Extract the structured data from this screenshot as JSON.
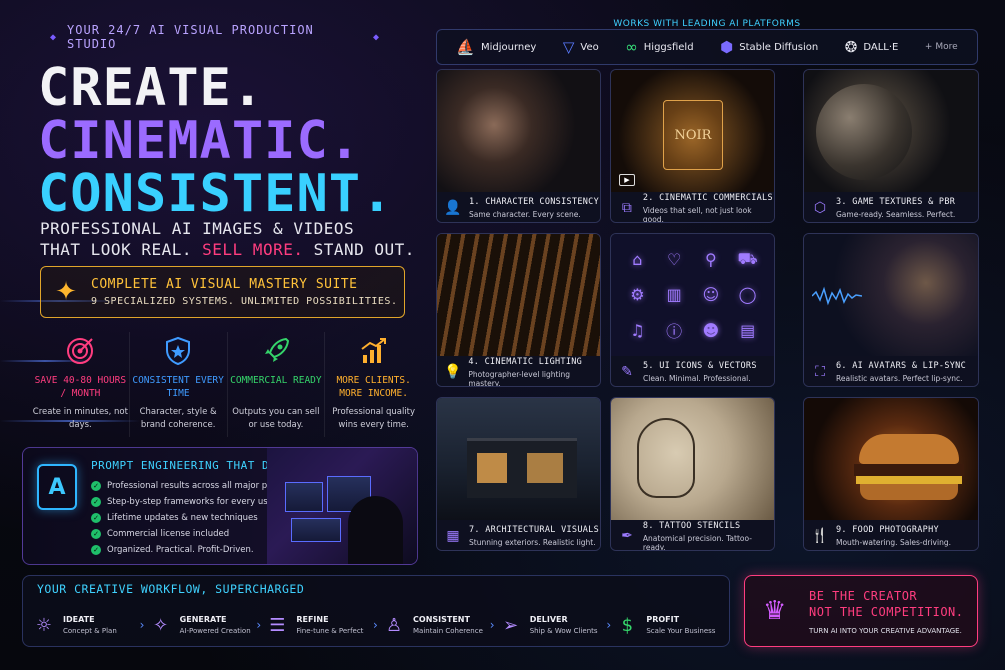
{
  "tagline": "YOUR 24/7 AI VISUAL PRODUCTION STUDIO",
  "headline": [
    "CREATE.",
    "CINEMATIC.",
    "CONSISTENT."
  ],
  "subhead": {
    "line1": "PROFESSIONAL AI IMAGES & VIDEOS",
    "line2_before": "THAT LOOK REAL.",
    "line2_highlight": "SELL MORE.",
    "line2_after": "STAND OUT."
  },
  "suite": {
    "title": "COMPLETE AI VISUAL MASTERY SUITE",
    "subtitle": "9 SPECIALIZED SYSTEMS. UNLIMITED POSSIBILITIES."
  },
  "benefits": [
    {
      "icon": "target-icon",
      "title": "SAVE 40-80 HOURS / MONTH",
      "desc": "Create in minutes, not days.",
      "color": "#ff3d7f"
    },
    {
      "icon": "shield-icon",
      "title": "CONSISTENT EVERY TIME",
      "desc": "Character, style & brand coherence.",
      "color": "#3f9bff"
    },
    {
      "icon": "rocket-icon",
      "title": "COMMERCIAL READY",
      "desc": "Outputs you can sell or use today.",
      "color": "#35d46a"
    },
    {
      "icon": "growth-chart-icon",
      "title": "MORE CLIENTS. MORE INCOME.",
      "desc": "Professional quality wins every time.",
      "color": "#ffb02e"
    }
  ],
  "prompt": {
    "badge": "A",
    "title": "PROMPT ENGINEERING THAT DELIVERS",
    "items": [
      "Professional results across all major platforms",
      "Step-by-step frameworks for every use case",
      "Lifetime updates & new techniques",
      "Commercial license included",
      "Organized. Practical. Profit-Driven."
    ]
  },
  "platforms": {
    "label": "WORKS WITH LEADING AI PLATFORMS",
    "items": [
      "Midjourney",
      "Veo",
      "Higgsfield",
      "Stable Diffusion",
      "DALL·E"
    ],
    "more": "+ More"
  },
  "cards": [
    {
      "title": "1. CHARACTER CONSISTENCY",
      "desc": "Same character. Every scene.",
      "icon": "user-icon"
    },
    {
      "title": "2. CINEMATIC COMMERCIALS",
      "desc": "Videos that sell, not just look good.",
      "icon": "layout-icon",
      "image_text": "NOIR"
    },
    {
      "title": "3. GAME TEXTURES & PBR",
      "desc": "Game-ready. Seamless. Perfect.",
      "icon": "cube-icon"
    },
    {
      "title": "4. CINEMATIC LIGHTING",
      "desc": "Photographer-level lighting mastery.",
      "icon": "bulb-icon"
    },
    {
      "title": "5. UI ICONS & VECTORS",
      "desc": "Clean. Minimal. Professional.",
      "icon": "pen-tool-icon"
    },
    {
      "title": "6. AI AVATARS & LIP-SYNC",
      "desc": "Realistic avatars. Perfect lip-sync.",
      "icon": "face-scan-icon"
    },
    {
      "title": "7. ARCHITECTURAL VISUALS",
      "desc": "Stunning exteriors. Realistic light.",
      "icon": "building-icon"
    },
    {
      "title": "8. TATTOO STENCILS",
      "desc": "Anatomical precision. Tattoo-ready.",
      "icon": "tattoo-pen-icon"
    },
    {
      "title": "9. FOOD PHOTOGRAPHY",
      "desc": "Mouth-watering. Sales-driving.",
      "icon": "cutlery-icon"
    }
  ],
  "workflow": {
    "title": "YOUR CREATIVE WORKFLOW, SUPERCHARGED",
    "steps": [
      {
        "label": "IDEATE",
        "desc": "Concept & Plan",
        "icon": "bulb-icon"
      },
      {
        "label": "GENERATE",
        "desc": "AI-Powered Creation",
        "icon": "sparkle-icon"
      },
      {
        "label": "REFINE",
        "desc": "Fine-tune & Perfect",
        "icon": "sliders-icon"
      },
      {
        "label": "CONSISTENT",
        "desc": "Maintain Coherence",
        "icon": "user-check-icon"
      },
      {
        "label": "DELIVER",
        "desc": "Ship & Wow Clients",
        "icon": "send-icon"
      },
      {
        "label": "PROFIT",
        "desc": "Scale Your Business",
        "icon": "dollar-icon"
      }
    ]
  },
  "creator": {
    "line1": "BE THE CREATOR",
    "line2": "NOT THE COMPETITION.",
    "desc": "TURN AI INTO YOUR CREATIVE ADVANTAGE."
  }
}
